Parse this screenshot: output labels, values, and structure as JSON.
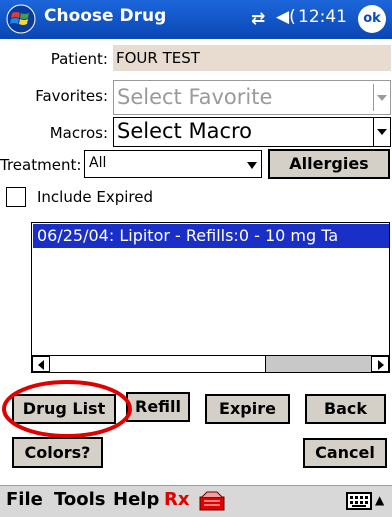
{
  "titlebar": {
    "title": "Choose Drug",
    "connectivity_icon": "⇄",
    "volume_icon": "◀(",
    "time": "12:41",
    "ok_label": "ok"
  },
  "form": {
    "patient_label": "Patient:",
    "patient_value": "FOUR TEST",
    "favorites_label": "Favorites:",
    "favorites_placeholder": "Select Favorite",
    "macros_label": "Macros:",
    "macros_value": "Select Macro",
    "treatment_label": "Treatment:",
    "treatment_value": "All",
    "allergies_button": "Allergies",
    "include_expired_label": "Include Expired",
    "include_expired_checked": false
  },
  "drug_list": {
    "items": [
      "06/25/04: Lipitor - Refills:0 - 10 mg Ta"
    ],
    "selected_index": 0
  },
  "buttons": {
    "drug_list": "Drug List",
    "refill": "Refill",
    "expire": "Expire",
    "back": "Back",
    "colors": "Colors?",
    "cancel": "Cancel"
  },
  "menubar": {
    "file": "File",
    "tools": "Tools",
    "help": "Help",
    "rx": "Rx",
    "keyboard_icon": "keyboard-icon",
    "up_arrow": "▲"
  },
  "colors": {
    "titlebar": "#0a46b4",
    "selection": "#1a2ec8",
    "rx_red": "#e00000",
    "highlight_circle": "#e00000"
  }
}
